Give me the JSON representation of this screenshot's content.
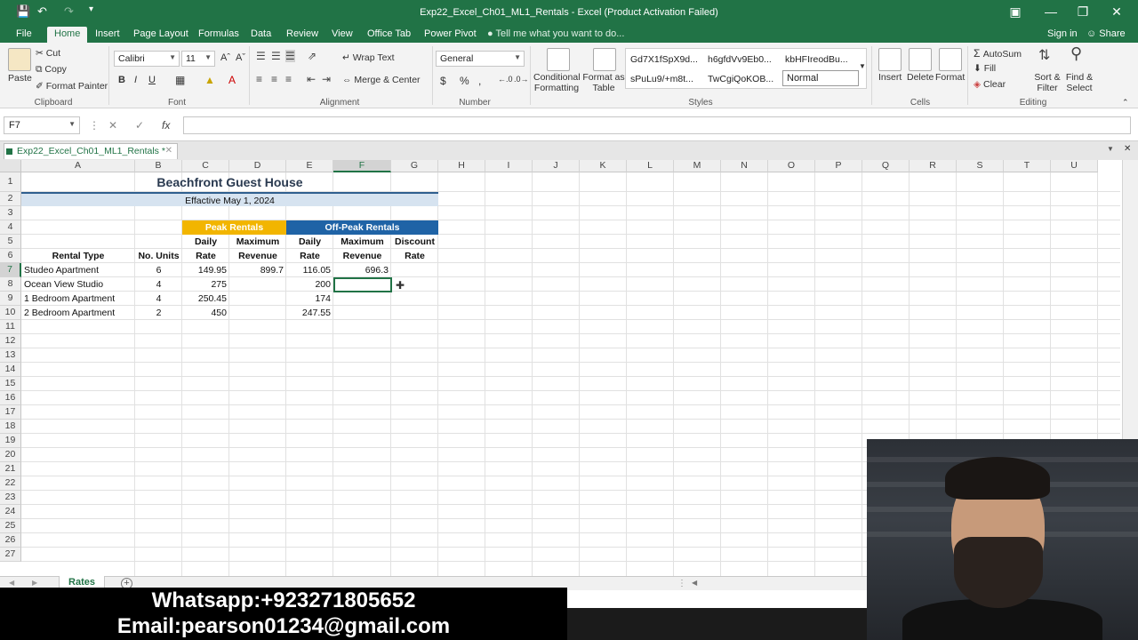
{
  "window": {
    "title": "Exp22_Excel_Ch01_ML1_Rentals - Excel (Product Activation Failed)"
  },
  "tabs": [
    "File",
    "Home",
    "Insert",
    "Page Layout",
    "Formulas",
    "Data",
    "Review",
    "View",
    "Office Tab",
    "Power Pivot"
  ],
  "tell_me": "Tell me what you want to do...",
  "sign_in": "Sign in",
  "share": "Share",
  "ribbon": {
    "clipboard": {
      "paste": "Paste",
      "cut": "Cut",
      "copy": "Copy",
      "format_painter": "Format Painter",
      "label": "Clipboard"
    },
    "font": {
      "name": "Calibri",
      "size": "11",
      "label": "Font"
    },
    "alignment": {
      "wrap": "Wrap Text",
      "merge": "Merge & Center",
      "label": "Alignment"
    },
    "number": {
      "format": "General",
      "label": "Number"
    },
    "styles": {
      "conditional": "Conditional Formatting",
      "format_as_table": "Format as Table",
      "gallery": [
        "Gd7X1fSpX9d...",
        "h6gfdVv9Eb0...",
        "kbHFIreodBu...",
        "sPuLu9/+m8t...",
        "TwCgiQoKOB...",
        "Normal"
      ],
      "label": "Styles"
    },
    "cells": {
      "insert": "Insert",
      "delete": "Delete",
      "format": "Format",
      "label": "Cells"
    },
    "editing": {
      "autosum": "AutoSum",
      "fill": "Fill",
      "clear": "Clear",
      "sort": "Sort & Filter",
      "find": "Find & Select",
      "label": "Editing"
    }
  },
  "name_box": "F7",
  "workbook_tab": "Exp22_Excel_Ch01_ML1_Rentals *",
  "columns": [
    "A",
    "B",
    "C",
    "D",
    "E",
    "F",
    "G",
    "H",
    "I",
    "J",
    "K",
    "L",
    "M",
    "N",
    "O",
    "P",
    "Q",
    "R",
    "S",
    "T",
    "U"
  ],
  "rows": [
    "1",
    "2",
    "3",
    "4",
    "5",
    "6",
    "7",
    "8",
    "9",
    "10",
    "11",
    "12",
    "13",
    "14",
    "15",
    "16",
    "17",
    "18",
    "19",
    "20",
    "21",
    "22",
    "23",
    "24",
    "25",
    "26",
    "27"
  ],
  "sheet": {
    "title": "Beachfront Guest House",
    "subtitle": "Effactive May 1, 2024",
    "peak": "Peak Rentals",
    "offpeak": "Off-Peak Rentals",
    "hdr_daily1": "Daily",
    "hdr_rate1": "Rate",
    "hdr_max1": "Maximum",
    "hdr_rev1": "Revenue",
    "hdr_daily2": "Daily",
    "hdr_rate2": "Rate",
    "hdr_max2": "Maximum",
    "hdr_rev2": "Revenue",
    "hdr_disc": "Discount",
    "hdr_discrate": "Rate",
    "hdr_type": "Rental Type",
    "hdr_units": "No. Units",
    "data": [
      {
        "type": "Studeo Apartment",
        "units": "6",
        "peak_rate": "149.95",
        "peak_rev": "899.7",
        "off_rate": "116.05",
        "off_rev": "696.3"
      },
      {
        "type": "Ocean View Studio",
        "units": "4",
        "peak_rate": "275",
        "peak_rev": "",
        "off_rate": "200",
        "off_rev": ""
      },
      {
        "type": "1 Bedroom Apartment",
        "units": "4",
        "peak_rate": "250.45",
        "peak_rev": "",
        "off_rate": "174",
        "off_rev": ""
      },
      {
        "type": "2 Bedroom Apartment",
        "units": "2",
        "peak_rate": "450",
        "peak_rev": "",
        "off_rate": "247.55",
        "off_rev": ""
      }
    ]
  },
  "sheet_tab": "Rates",
  "overlay": {
    "whatsapp": "Whatsapp:+923271805652",
    "email": "Email:pearson01234@gmail.com"
  }
}
